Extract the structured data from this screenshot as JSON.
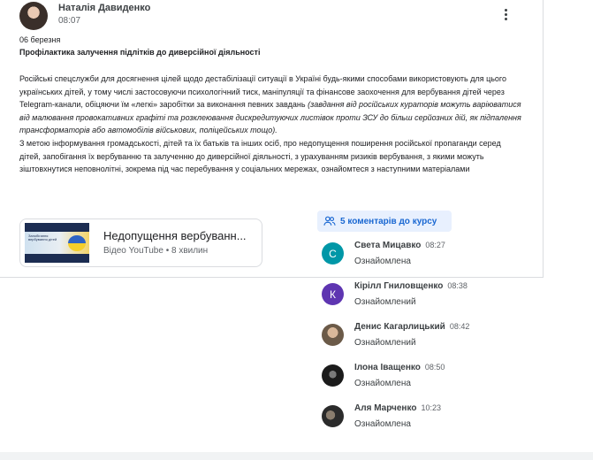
{
  "post": {
    "author": "Наталія Давиденко",
    "time": "08:07",
    "date": "06 березня",
    "title": "Профілактика залучення підлітків до диверсійної діяльності",
    "body_p1_plain": "Російські спецслужби для досягнення цілей щодо дестабілізації ситуації в Україні будь-якими способами використовують для цього українських дітей, у тому числі застосовуючи психологічний тиск, маніпуляції та фінансове заохочення для вербування дітей через Telegram-канали, обіцяючи їм «легкі» заробітки за виконання певних завдань",
    "body_p1_italic": "(завдання від російських кураторів можуть варіюватися від малювання провокативних графіті та розклеювання дискредитуючих листівок проти ЗСУ до більш серйозних дій, як підпалення трансформаторів або автомобілів військових, поліцейських тощо).",
    "body_p2": " З метою інформування громадськості, дітей та їх батьків та інших осіб, про недопущення поширення російської пропаганди серед дітей, запобігання їх вербуванню та залученню до диверсійної діяльності, з урахуванням ризиків вербування, з якими можуть зіштовхнутися неповнолітні, зокрема під час перебування у соціальних мережах, ознайомтеся з наступними матеріалами",
    "menu_icon": "more-vert-icon"
  },
  "attachment": {
    "title": "Недопущення вербуванн...",
    "subtitle": "Відео YouTube • 8 хвилин",
    "thumb_text": "Запобігання вербування дітей"
  },
  "comments": {
    "header": "5 коментарів до курсу",
    "header_icon": "people-icon",
    "items": [
      {
        "initial": "С",
        "name": "Света Мицавко",
        "time": "08:27",
        "text": "Ознайомлена",
        "avatar_color": "#0097a7"
      },
      {
        "initial": "К",
        "name": "Кірілл Гниловщенко",
        "time": "08:38",
        "text": "Ознайомлений",
        "avatar_color": "#5e35b1"
      },
      {
        "initial": "",
        "name": "Денис Кагарлицький",
        "time": "08:42",
        "text": "Ознайомлений",
        "avatar_color": "#8d7b6a"
      },
      {
        "initial": "",
        "name": "Ілона Іващенко",
        "time": "08:50",
        "text": "Ознайомлена",
        "avatar_color": "#1b1b1b"
      },
      {
        "initial": "",
        "name": "Аля Марченко",
        "time": "10:23",
        "text": "Ознайомлена",
        "avatar_color": "#2b2b2b"
      }
    ]
  }
}
